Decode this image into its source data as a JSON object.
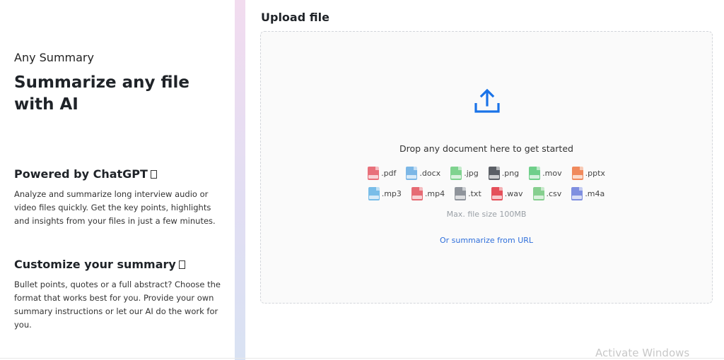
{
  "left": {
    "brand": "Any Summary",
    "headline": "Summarize any file with AI",
    "powered": {
      "title": "Powered by ChatGPT",
      "body": "Analyze and summarize long interview audio or video files quickly. Get the key points, highlights and insights from your files in just a few minutes."
    },
    "customize": {
      "title": "Customize your summary",
      "body": "Bullet points, quotes or a full abstract? Choose the format that works best for you. Provide your own summary instructions or let our AI do the work for you."
    }
  },
  "upload": {
    "title": "Upload file",
    "drop_text": "Drop any document here to get started",
    "max_size": "Max. file size 100MB",
    "url_link": "Or summarize from URL",
    "icon": "upload-arrow-icon",
    "accent": "#1a73e8",
    "file_types_row1": [
      {
        "ext": ".pdf",
        "color": "#e8707a"
      },
      {
        "ext": ".docx",
        "color": "#7cb7e6"
      },
      {
        "ext": ".jpg",
        "color": "#7fd38f"
      },
      {
        "ext": ".png",
        "color": "#5b5f66"
      },
      {
        "ext": ".mov",
        "color": "#6fcf8a"
      },
      {
        "ext": ".pptx",
        "color": "#f08a5d"
      }
    ],
    "file_types_row2": [
      {
        "ext": ".mp3",
        "color": "#79bde8"
      },
      {
        "ext": ".mp4",
        "color": "#e66b74"
      },
      {
        "ext": ".txt",
        "color": "#8f949b"
      },
      {
        "ext": ".wav",
        "color": "#e5505a"
      },
      {
        "ext": ".csv",
        "color": "#86cf8f"
      },
      {
        "ext": ".m4a",
        "color": "#7f8fe0"
      }
    ]
  },
  "watermark": "Activate Windows"
}
